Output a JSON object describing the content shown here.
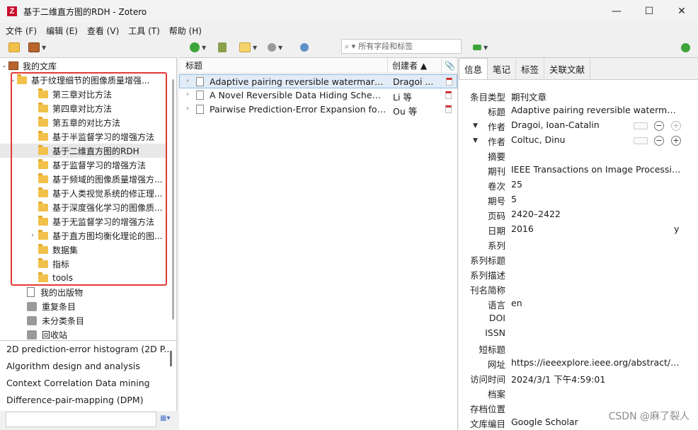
{
  "window": {
    "title": "基于二维直方图的RDH - Zotero",
    "logo": "Z",
    "minimize": "—",
    "maximize": "☐",
    "close": "✕"
  },
  "menu": [
    "文件 (F)",
    "编辑 (E)",
    "查看 (V)",
    "工具 (T)",
    "帮助 (H)"
  ],
  "search": {
    "placeholder": "所有字段和标签"
  },
  "library": {
    "root": "我的文库",
    "collections": [
      "基于纹理细节的图像质量增强...",
      "第三章对比方法",
      "第四章对比方法",
      "第五章的对比方法",
      "基于半监督学习的增强方法",
      "基于二维直方图的RDH",
      "基于监督学习的增强方法",
      "基于频域的图像质量增强方...",
      "基于人类视觉系统的修正理...",
      "基于深度强化学习的图像质...",
      "基于无监督学习的增强方法",
      "基于直方图均衡化理论的图...",
      "数据集",
      "指标",
      "tools"
    ],
    "extras": [
      "我的出版物",
      "重复条目",
      "未分类条目",
      "回收站"
    ]
  },
  "tags": [
    "2D prediction-error histogram (2D P...",
    "Algorithm design and analysis",
    "Context   Correlation   Data mining",
    "Difference-pair-mapping (DPM)"
  ],
  "items": {
    "columns": {
      "title": "标题",
      "creator": "创建者 ▲",
      "attach": "📎"
    },
    "rows": [
      {
        "title": "Adaptive pairing reversible watermarking",
        "creator": "Dragoi ..."
      },
      {
        "title": "A Novel Reversible Data Hiding Scheme ...",
        "creator": "Li 等"
      },
      {
        "title": "Pairwise Prediction-Error Expansion for Ef...",
        "creator": "Ou 等"
      }
    ]
  },
  "detail": {
    "tabs": [
      "信息",
      "笔记",
      "标签",
      "关联文献"
    ],
    "fields": [
      {
        "label": "条目类型",
        "value": "期刊文章"
      },
      {
        "label": "标题",
        "value": "Adaptive pairing reversible watermarking"
      },
      {
        "label": "作者",
        "value": "Dragoi, Ioan-Catalin"
      },
      {
        "label": "作者",
        "value": "Coltuc, Dinu"
      },
      {
        "label": "摘要",
        "value": ""
      },
      {
        "label": "期刊",
        "value": "IEEE Transactions on Image Processing"
      },
      {
        "label": "卷次",
        "value": "25"
      },
      {
        "label": "期号",
        "value": "5"
      },
      {
        "label": "页码",
        "value": "2420–2422"
      },
      {
        "label": "日期",
        "value": "2016"
      },
      {
        "label": "系列",
        "value": ""
      },
      {
        "label": "系列标题",
        "value": ""
      },
      {
        "label": "系列描述",
        "value": ""
      },
      {
        "label": "刊名简称",
        "value": ""
      },
      {
        "label": "语言",
        "value": "en"
      },
      {
        "label": "DOI",
        "value": ""
      },
      {
        "label": "ISSN",
        "value": ""
      },
      {
        "label": "短标题",
        "value": ""
      },
      {
        "label": "网址",
        "value": "https://ieeexplore.ieee.org/abstract/do..."
      },
      {
        "label": "访问时间",
        "value": "2024/3/1 下午4:59:01"
      },
      {
        "label": "档案",
        "value": ""
      },
      {
        "label": "存档位置",
        "value": ""
      },
      {
        "label": "文库编目",
        "value": "Google Scholar"
      }
    ],
    "date_suffix": "y"
  },
  "watermark": "CSDN @麻了裂人"
}
